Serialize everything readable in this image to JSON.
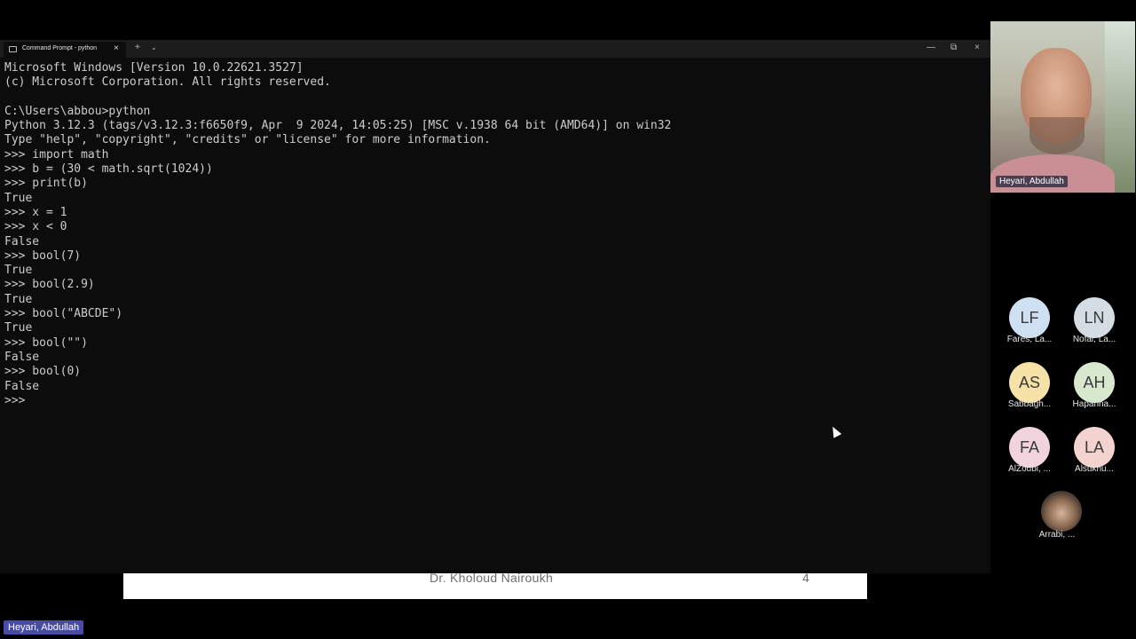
{
  "slide": {
    "footer_name": "Dr. Kholoud Nairoukh",
    "page_number": "4"
  },
  "terminal": {
    "tab_title": "Command Prompt - python",
    "tab_close": "×",
    "new_tab": "+",
    "dropdown": "⌄",
    "minimize": "—",
    "maximize": "⧉",
    "close": "×",
    "lines": [
      "Microsoft Windows [Version 10.0.22621.3527]",
      "(c) Microsoft Corporation. All rights reserved.",
      "",
      "C:\\Users\\abbou>python",
      "Python 3.12.3 (tags/v3.12.3:f6650f9, Apr  9 2024, 14:05:25) [MSC v.1938 64 bit (AMD64)] on win32",
      "Type \"help\", \"copyright\", \"credits\" or \"license\" for more information.",
      ">>> import math",
      ">>> b = (30 < math.sqrt(1024))",
      ">>> print(b)",
      "True",
      ">>> x = 1",
      ">>> x < 0",
      "False",
      ">>> bool(7)",
      "True",
      ">>> bool(2.9)",
      "True",
      ">>> bool(\"ABCDE\")",
      "True",
      ">>> bool(\"\")",
      "False",
      ">>> bool(0)",
      "False",
      ">>>"
    ]
  },
  "meeting": {
    "speaker_name": "Heyari, Abdullah",
    "participants": [
      {
        "initials": "LF",
        "name": "Fares, La...",
        "color": "#cfe0f3"
      },
      {
        "initials": "LN",
        "name": "Nofal, La...",
        "color": "#d3dde3"
      },
      {
        "initials": "AS",
        "name": "Sabbagh...",
        "color": "#f6e2a6"
      },
      {
        "initials": "AH",
        "name": "Hapanna...",
        "color": "#d8e8cf"
      },
      {
        "initials": "FA",
        "name": "AlZoubi, ...",
        "color": "#f1d3dd"
      },
      {
        "initials": "LA",
        "name": "Alsukhu...",
        "color": "#f3d3cf"
      }
    ],
    "photo_participant_name": "Arrabi, ...",
    "bottom_name_tag": "Heyari, Abdullah"
  }
}
